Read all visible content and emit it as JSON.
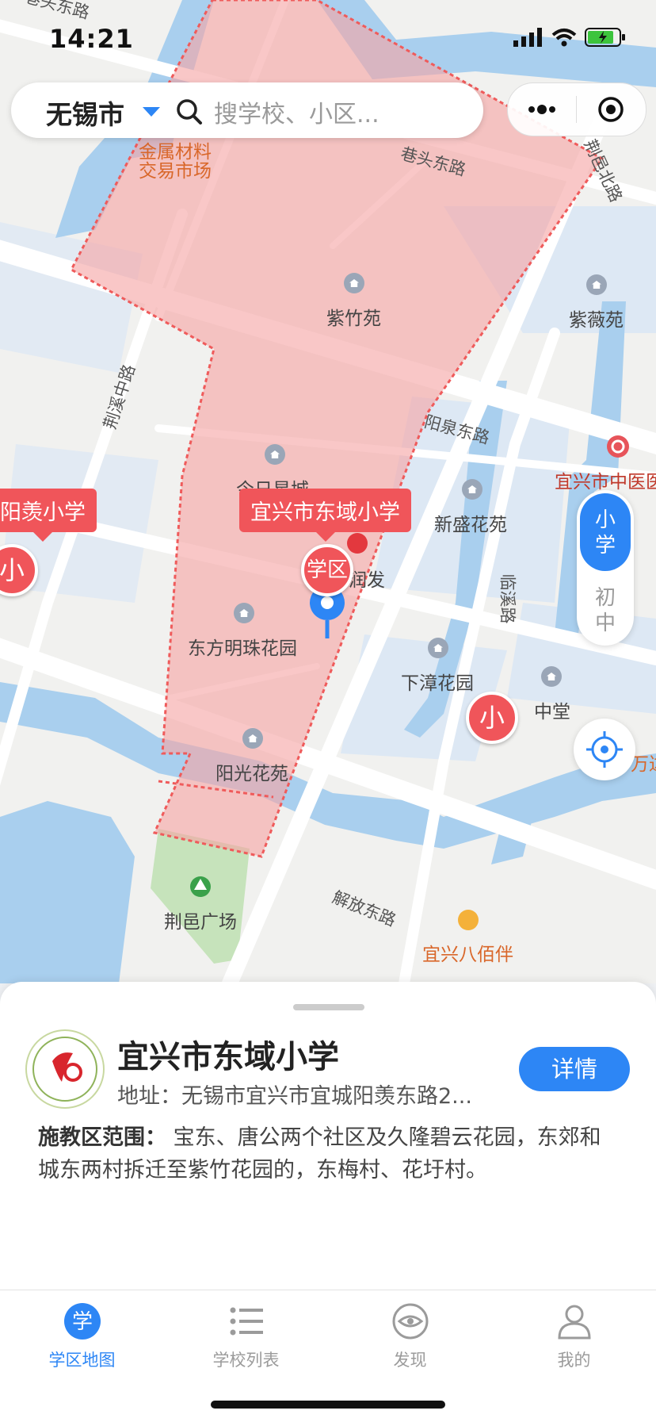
{
  "status_bar": {
    "time": "14:21"
  },
  "search": {
    "city": "无锡市",
    "placeholder": "搜学校、小区..."
  },
  "map": {
    "roads": [
      "巷头东路",
      "荆邑北路",
      "巷头东路",
      "荆溪中路",
      "阳泉东路",
      "临溪路",
      "解放东路"
    ],
    "places": [
      "金属材料交易市场",
      "紫竹苑",
      "紫薇苑",
      "今日星城",
      "新盛花苑",
      "宜兴市中医医院",
      "润发",
      "东方明珠花园",
      "下漳花园",
      "中堂",
      "阳光花苑",
      "荆邑广场",
      "宜兴八佰伴",
      "万达"
    ],
    "callouts": {
      "main": "宜兴市东域小学",
      "left": "阳羡小学"
    },
    "pin_labels": {
      "district": "学区",
      "small": "小"
    },
    "level_toggle": {
      "active": "小学",
      "inactive": "初中"
    },
    "colors": {
      "district_fill": "#f5a5a5",
      "marker": "#f0555a",
      "accent": "#2d86f5",
      "water": "#a9cfee",
      "park": "#c6e3bb"
    }
  },
  "school": {
    "name": "宜兴市东域小学",
    "address": "地址：无锡市宜兴市宜城阳羡东路2...",
    "detail_button": "详情",
    "scope_label": "施教区范围：",
    "scope_text": "宝东、唐公两个社区及久隆碧云花园，东郊和城东两村拆迁至紫竹花园的，东梅村、花圩村。"
  },
  "tabs": [
    {
      "label": "学区地图",
      "icon": "xue-icon",
      "active": true
    },
    {
      "label": "学校列表",
      "icon": "list-icon",
      "active": false
    },
    {
      "label": "发现",
      "icon": "eye-icon",
      "active": false
    },
    {
      "label": "我的",
      "icon": "user-icon",
      "active": false
    }
  ]
}
